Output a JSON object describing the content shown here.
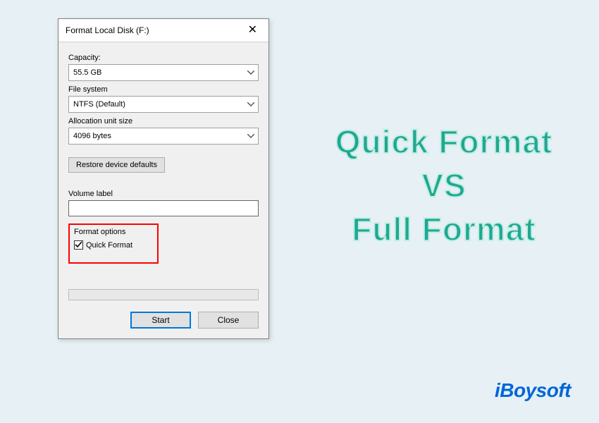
{
  "dialog": {
    "title": "Format Local Disk (F:)",
    "capacity": {
      "label": "Capacity:",
      "value": "55.5 GB"
    },
    "filesystem": {
      "label": "File system",
      "value": "NTFS (Default)"
    },
    "allocation": {
      "label": "Allocation unit size",
      "value": "4096 bytes"
    },
    "restore_label": "Restore device defaults",
    "volume": {
      "label": "Volume label",
      "value": ""
    },
    "format_options": {
      "group_label": "Format options",
      "quick_format_label": "Quick Format",
      "quick_format_checked": true
    },
    "buttons": {
      "start": "Start",
      "close": "Close"
    }
  },
  "headline": {
    "line1": "Quick Format",
    "line2": "VS",
    "line3": "Full Format"
  },
  "brand": "iBoysoft",
  "colors": {
    "highlight_box": "#ff0000",
    "headline_fill": "#1fa891",
    "brand": "#0066d6"
  }
}
